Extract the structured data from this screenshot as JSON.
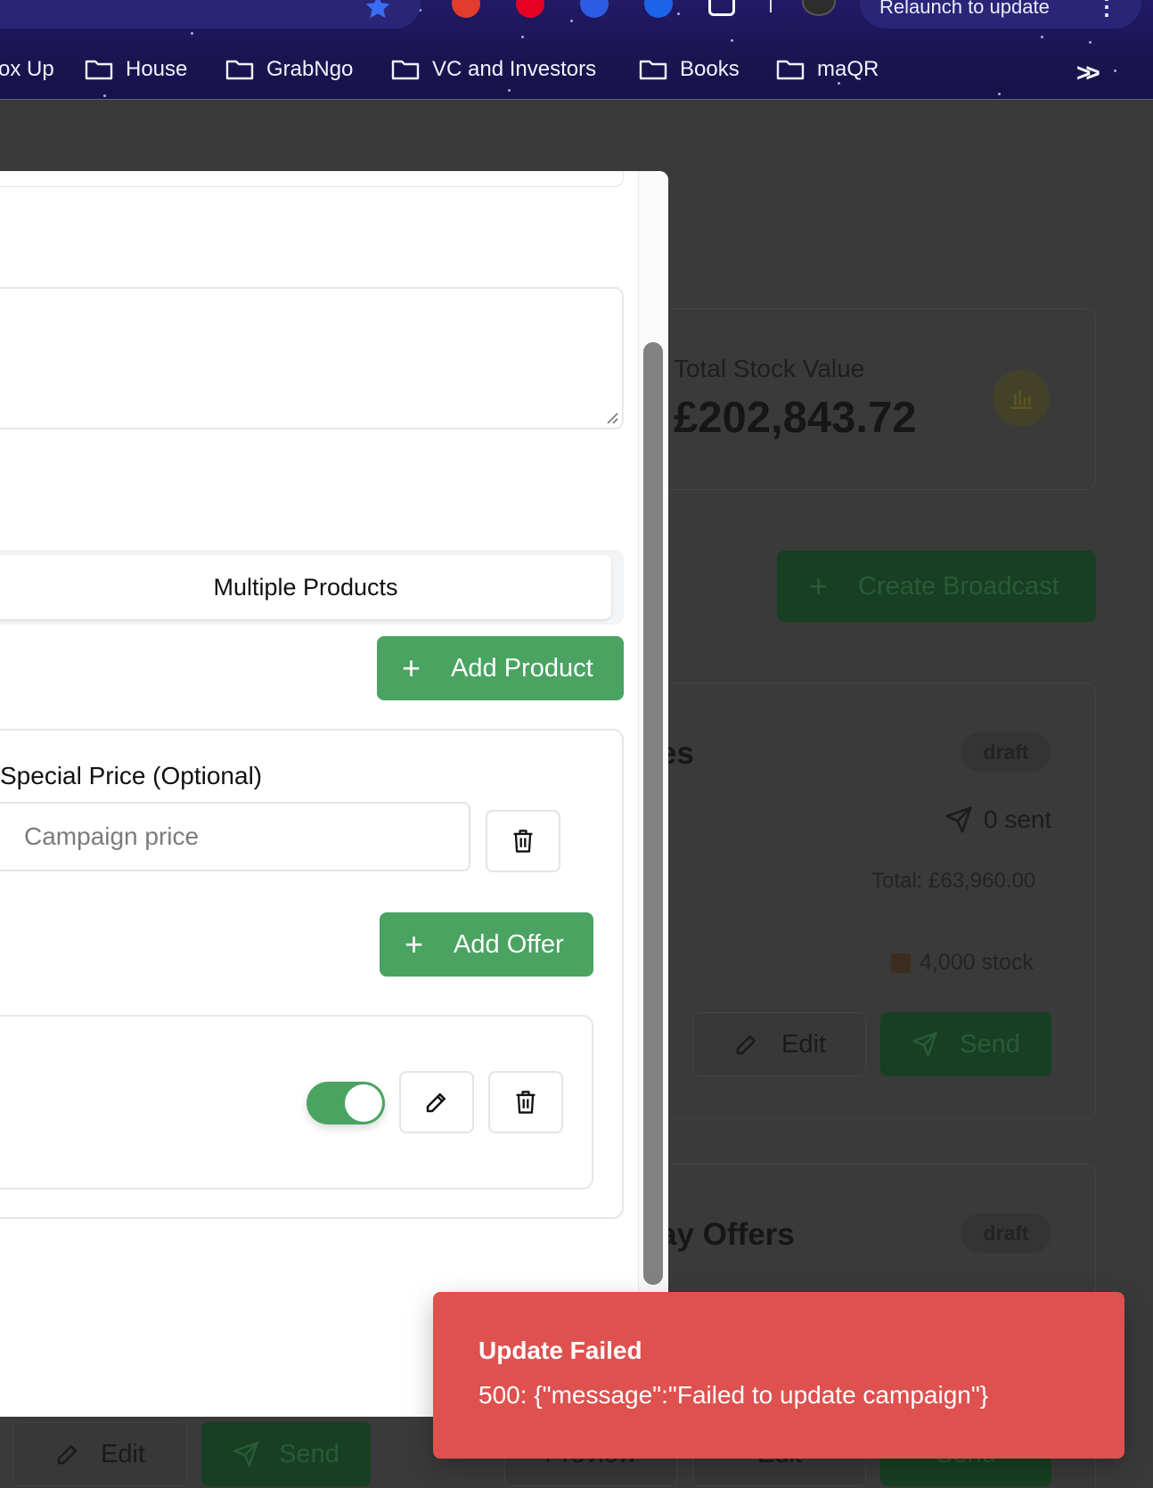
{
  "browser": {
    "relaunch_label": "Relaunch to update",
    "bookmarks": [
      {
        "label": "ox Up",
        "folder": false
      },
      {
        "label": "House",
        "folder": true
      },
      {
        "label": "GrabNgo",
        "folder": true
      },
      {
        "label": "VC and Investors",
        "folder": true
      },
      {
        "label": "Books",
        "folder": true
      },
      {
        "label": "maQR",
        "folder": true
      }
    ],
    "more_label": ">>"
  },
  "background": {
    "stock": {
      "label": "Total Stock Value",
      "value": "£202,843.72",
      "icon": "bar-chart-icon"
    },
    "create_broadcast_label": "Create Broadcast",
    "campaign1": {
      "title_fragment": "es",
      "status": "draft",
      "sent": "0 sent",
      "total": "Total: £63,960.00",
      "stock": "4,000 stock",
      "edit_label": "Edit",
      "send_label": "Send"
    },
    "campaign2": {
      "title_fragment": "ay Offers",
      "status": "draft"
    },
    "bottom_bar": {
      "edit_label": "Edit",
      "send_label": "Send",
      "preview_label": "Preview",
      "edit2_label": "Edit",
      "send2_label": "Send"
    }
  },
  "modal": {
    "mode_selected": "Multiple Products",
    "add_product_label": "Add Product",
    "special_price_label": "Special Price (Optional)",
    "special_price": {
      "value": "",
      "placeholder": "Campaign price"
    },
    "add_offer_label": "Add Offer",
    "offer_active": true
  },
  "toast": {
    "title": "Update Failed",
    "message": "500: {\"message\":\"Failed to update campaign\"}"
  },
  "colors": {
    "accent": "#4aa361",
    "error": "#de514f",
    "chrome": "#1a1450"
  }
}
